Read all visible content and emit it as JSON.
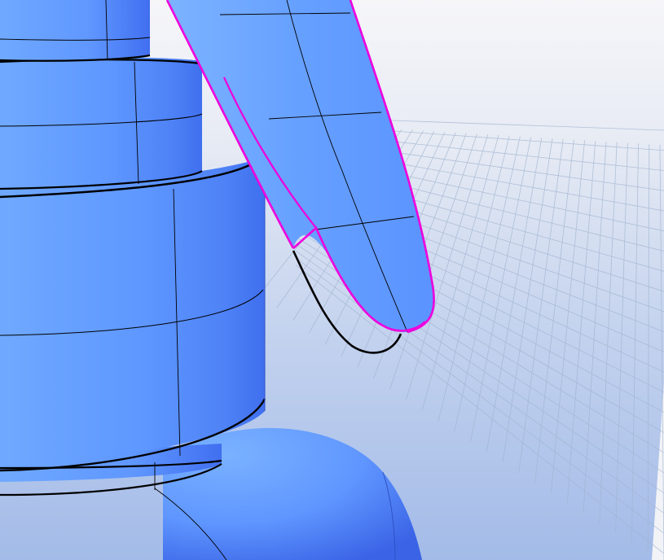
{
  "viewport": {
    "background_top": "#f6f6f9",
    "background_bottom": "#a9c0e9",
    "grid_line": "#9fb3cf",
    "surface_blue": "#5f98ff",
    "surface_dark": "#3f6ff0",
    "surface_light": "#7db4ff",
    "edge_black": "#000000",
    "selection_highlight": "#ee00dd"
  },
  "objects": [
    {
      "name": "cylinder-body-stack",
      "selected": false
    },
    {
      "name": "dome-base",
      "selected": false
    },
    {
      "name": "curved-tube",
      "selected": true
    },
    {
      "name": "open-curve",
      "selected": false
    },
    {
      "name": "construction-grid",
      "selected": false
    }
  ]
}
